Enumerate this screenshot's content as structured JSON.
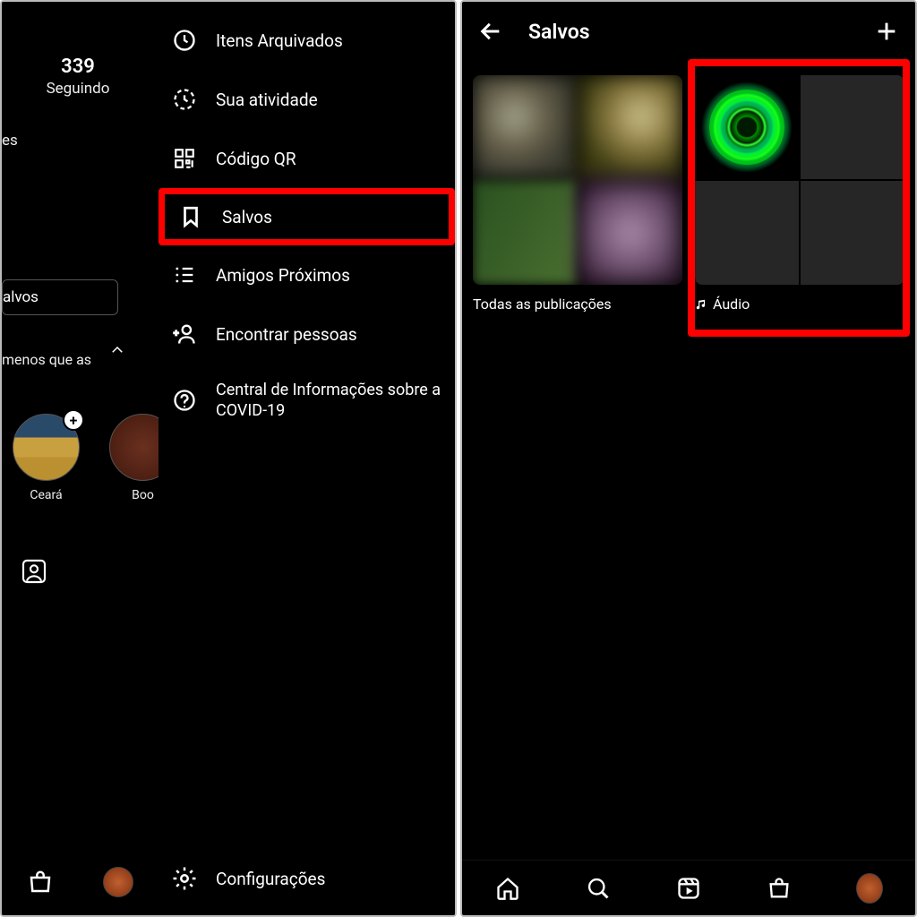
{
  "left": {
    "stats_count": "339",
    "stats_label": "Seguindo",
    "following_partial": "es",
    "salvos_button": "alvos",
    "warning": "menos que as",
    "highlights": [
      {
        "name": "Ceará"
      },
      {
        "name": "Boo"
      }
    ],
    "menu": [
      {
        "label": "Itens Arquivados"
      },
      {
        "label": "Sua atividade"
      },
      {
        "label": "Código QR"
      },
      {
        "label": "Salvos",
        "highlighted": true
      },
      {
        "label": "Amigos Próximos"
      },
      {
        "label": "Encontrar pessoas"
      },
      {
        "label": "Central de Informações sobre a COVID-19"
      }
    ],
    "settings": "Configurações"
  },
  "right": {
    "title": "Salvos",
    "collections": {
      "all": "Todas as publicações",
      "audio": "Áudio"
    }
  }
}
